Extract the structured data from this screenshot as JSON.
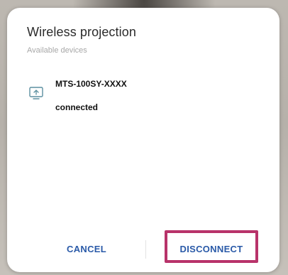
{
  "dialog": {
    "title": "Wireless projection",
    "subtitle": "Available devices"
  },
  "device": {
    "icon": "cast-display-icon",
    "name": "MTS-100SY-XXXX",
    "status": "connected"
  },
  "actions": {
    "cancel_label": "CANCEL",
    "disconnect_label": "DISCONNECT"
  },
  "colors": {
    "accent": "#2a5aa8",
    "highlight": "#b8336a"
  }
}
